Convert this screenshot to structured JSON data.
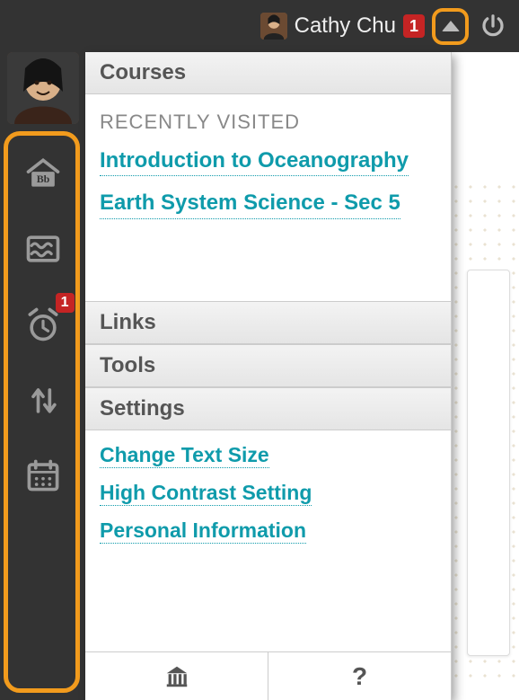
{
  "header": {
    "user_name": "Cathy Chu",
    "notification_count": "1"
  },
  "rail": {
    "alarm_badge": "1"
  },
  "panel": {
    "courses_label": "Courses",
    "recent_label": "RECENTLY VISITED",
    "recent": [
      "Introduction to Oceanography",
      "Earth System Science - Sec 5"
    ],
    "links_label": "Links",
    "tools_label": "Tools",
    "settings_label": "Settings",
    "settings": [
      "Change Text Size",
      "High Contrast Setting",
      "Personal Information"
    ],
    "help_label": "?"
  }
}
